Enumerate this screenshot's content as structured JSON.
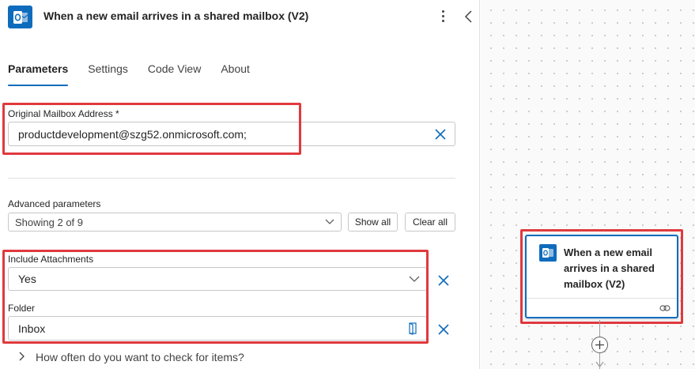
{
  "header": {
    "title": "When a new email arrives in a shared mailbox (V2)",
    "icon": "outlook-icon"
  },
  "tabs": [
    {
      "label": "Parameters",
      "active": true
    },
    {
      "label": "Settings",
      "active": false
    },
    {
      "label": "Code View",
      "active": false
    },
    {
      "label": "About",
      "active": false
    }
  ],
  "mailbox": {
    "label": "Original Mailbox Address *",
    "value": "productdevelopment@szg52.onmicrosoft.com;"
  },
  "advanced": {
    "label": "Advanced parameters",
    "selected": "Showing 2 of 9",
    "show_all": "Show all",
    "clear_all": "Clear all"
  },
  "attachments": {
    "label": "Include Attachments",
    "value": "Yes"
  },
  "folder": {
    "label": "Folder",
    "value": "Inbox"
  },
  "more": {
    "label": "How often do you want to check for items?"
  },
  "card": {
    "title": "When a new email arrives in a shared mailbox (V2)"
  },
  "colors": {
    "accent": "#0f6cbd",
    "highlight": "#e0393e"
  }
}
